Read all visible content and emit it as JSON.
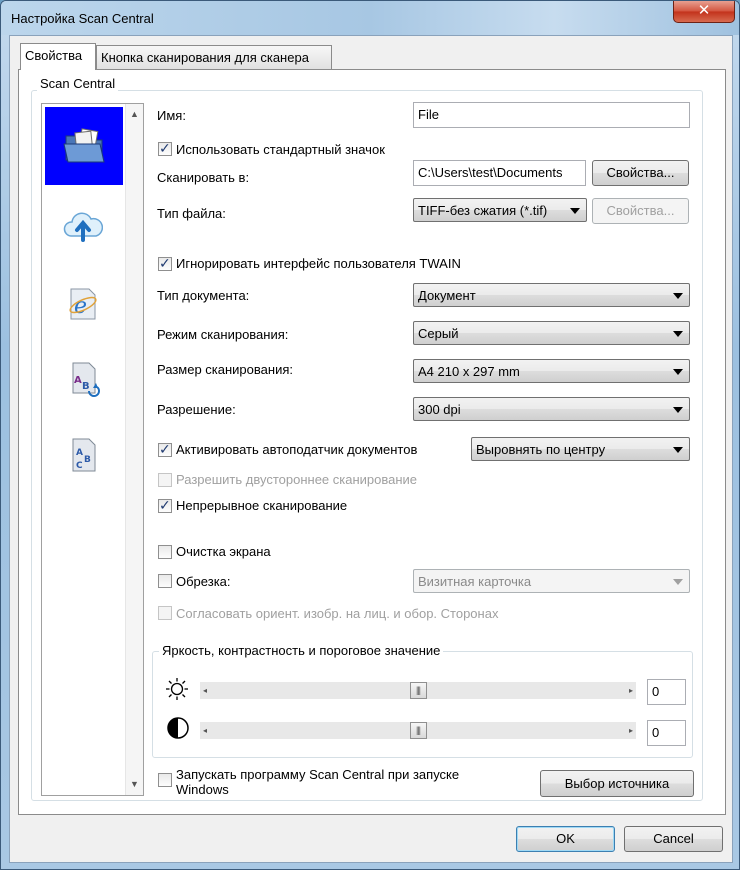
{
  "window": {
    "title": "Настройка Scan Central",
    "close_glyph": "✕"
  },
  "tabs": [
    {
      "label": "Свойства",
      "active": true
    },
    {
      "label": "Кнопка сканирования для сканера",
      "active": false
    }
  ],
  "group": {
    "title": "Scan Central"
  },
  "sidebar": {
    "icons": [
      "folder-document-icon",
      "cloud-upload-icon",
      "internet-explorer-icon",
      "ocr-document-icon",
      "text-document-icon"
    ],
    "selected_index": 0,
    "scroll_up": "▲",
    "scroll_down": "▼"
  },
  "form": {
    "name_label": "Имя:",
    "name_value": "File",
    "use_default_icon_label": "Использовать стандартный значок",
    "use_default_icon_checked": true,
    "scan_to_label": "Сканировать в:",
    "scan_to_value": "C:\\Users\\test\\Documents",
    "properties_button": "Свойства...",
    "file_type_label": "Тип файла:",
    "file_type_value": "TIFF-без сжатия (*.tif)",
    "file_properties_button": "Свойства...",
    "ignore_twain_label": "Игнорировать интерфейс пользователя TWAIN",
    "ignore_twain_checked": true,
    "doc_type_label": "Тип документа:",
    "doc_type_value": "Документ",
    "scan_mode_label": "Режим сканирования:",
    "scan_mode_value": "Серый",
    "scan_size_label": "Размер сканирования:",
    "scan_size_value": "A4 210 x 297 mm",
    "resolution_label": "Разрешение:",
    "resolution_value": "300  dpi",
    "adf_label": "Активировать автоподатчик документов",
    "adf_checked": true,
    "align_value": "Выровнять по центру",
    "duplex_label": "Разрешить двустороннее сканирование",
    "duplex_checked": false,
    "continuous_label": "Непрерывное сканирование",
    "continuous_checked": true,
    "clean_screen_label": "Очистка экрана",
    "clean_screen_checked": false,
    "crop_label": "Обрезка:",
    "crop_checked": false,
    "crop_value": "Визитная карточка",
    "orient_label": "Согласовать ориент. изобр. на лиц. и обор. Сторонах",
    "orient_checked": false,
    "bct_title": "Яркость, контрастность и пороговое значение",
    "brightness_value": "0",
    "brightness_level": 0.5,
    "contrast_value": "0",
    "contrast_level": 0.5,
    "slider_thumb_glyph": "|||",
    "slider_left_glyph": "◂",
    "slider_right_glyph": "▸",
    "autostart_label_line1": "Запускать программу Scan Central при запуске",
    "autostart_label_line2": "Windows",
    "autostart_checked": false,
    "select_source_button": "Выбор источника"
  },
  "footer": {
    "ok_button": "OK",
    "cancel_button": "Cancel"
  },
  "check_glyph": "✓"
}
